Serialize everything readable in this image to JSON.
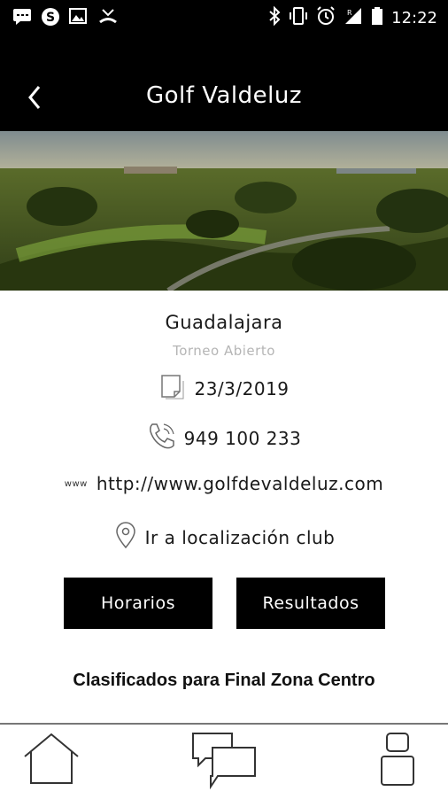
{
  "status_bar": {
    "time": "12:22",
    "left_icons": [
      "message-icon",
      "skype-icon",
      "image-icon",
      "missed-call-icon"
    ],
    "right_icons": [
      "bluetooth-icon",
      "vibrate-icon",
      "alarm-icon",
      "signal-icon",
      "battery-icon"
    ]
  },
  "header": {
    "title": "Golf Valdeluz",
    "back_icon": "back-arrow-icon"
  },
  "club": {
    "city": "Guadalajara",
    "tournament_type": "Torneo Abierto",
    "date": "23/3/2019",
    "phone": "949 100 233",
    "website": "http://www.golfdevaldeluz.com",
    "website_icon_text": "www",
    "location_link": "Ir a localización club"
  },
  "buttons": {
    "schedule": "Horarios",
    "results": "Resultados"
  },
  "section": {
    "title": "Clasificados para Final Zona Centro"
  },
  "tab_bar": {
    "items": [
      "home-icon",
      "chat-icon",
      "profile-icon"
    ]
  },
  "colors": {
    "header_bg": "#000000",
    "button_bg": "#000000",
    "subtitle_text": "#b5b5b5"
  }
}
